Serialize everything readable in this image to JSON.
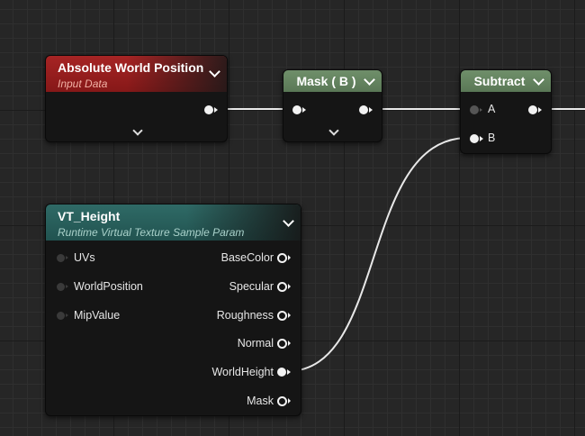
{
  "graph": {
    "nodes": {
      "absolute_world_position": {
        "title": "Absolute World Position",
        "subtitle": "Input Data"
      },
      "mask_b": {
        "title": "Mask ( B )"
      },
      "subtract": {
        "title": "Subtract",
        "inputs": [
          "A",
          "B"
        ]
      },
      "vt_height": {
        "title": "VT_Height",
        "subtitle": "Runtime Virtual Texture Sample Param",
        "inputs": [
          "UVs",
          "WorldPosition",
          "MipValue"
        ],
        "outputs": [
          "BaseColor",
          "Specular",
          "Roughness",
          "Normal",
          "WorldHeight",
          "Mask"
        ]
      }
    },
    "colors": {
      "header_input": "#9c2020",
      "header_math": "#6b8a67",
      "header_param": "#2a625e",
      "wire": "#e8e8e8"
    }
  }
}
